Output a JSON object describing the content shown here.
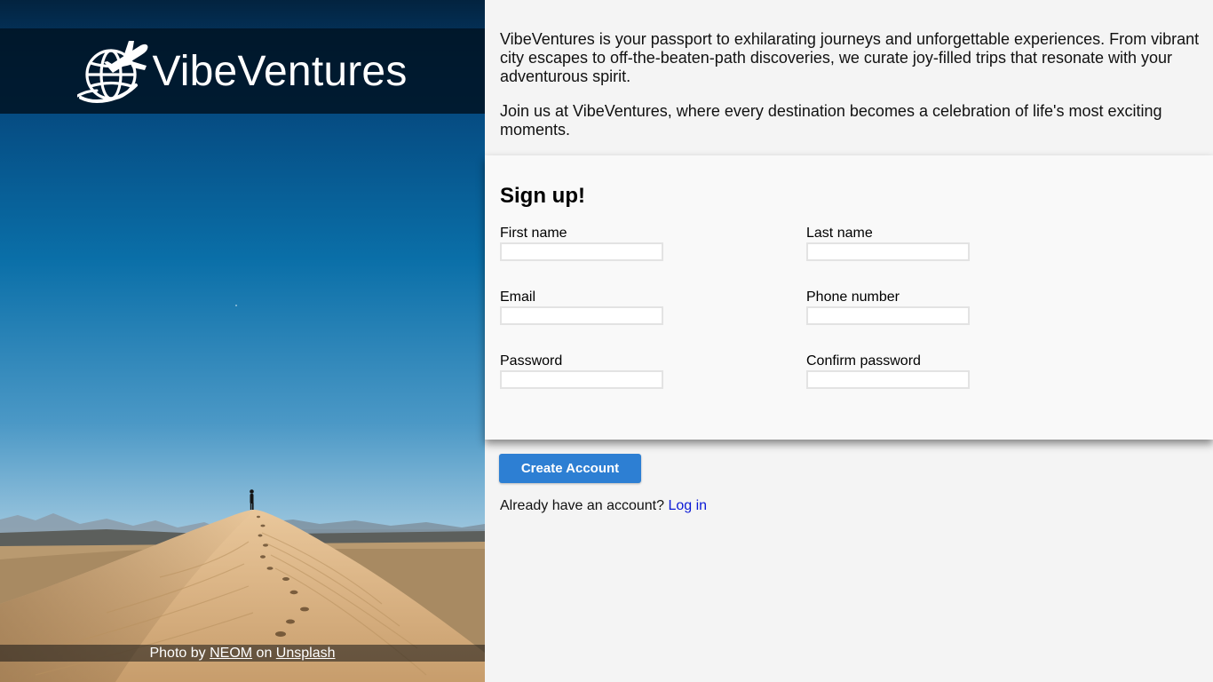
{
  "brand": {
    "name": "VibeVentures",
    "logo_icon": "globe-airplane-icon"
  },
  "photo_credit": {
    "prefix": "Photo by",
    "author": "NEOM",
    "middle": "on",
    "site": "Unsplash"
  },
  "intro": {
    "paragraph1": "VibeVentures is your passport to exhilarating journeys and unforgettable experiences. From vibrant city escapes to off-the-beaten-path discoveries, we curate joy-filled trips that resonate with your adventurous spirit.",
    "paragraph2": "Join us at VibeVentures, where every destination becomes a celebration of life's most exciting moments."
  },
  "signup": {
    "title": "Sign up!",
    "fields": {
      "first_name": {
        "label": "First name",
        "value": ""
      },
      "last_name": {
        "label": "Last name",
        "value": ""
      },
      "email": {
        "label": "Email",
        "value": ""
      },
      "phone": {
        "label": "Phone number",
        "value": ""
      },
      "password": {
        "label": "Password",
        "value": ""
      },
      "confirm_password": {
        "label": "Confirm password",
        "value": ""
      }
    },
    "submit_label": "Create Account"
  },
  "login": {
    "prompt": "Already have an account?",
    "link_label": "Log in"
  },
  "colors": {
    "accent_button": "#2d7fd3",
    "link": "#0a19d6",
    "brand_bar": "#001426",
    "panel_background": "#f4f4f4"
  }
}
